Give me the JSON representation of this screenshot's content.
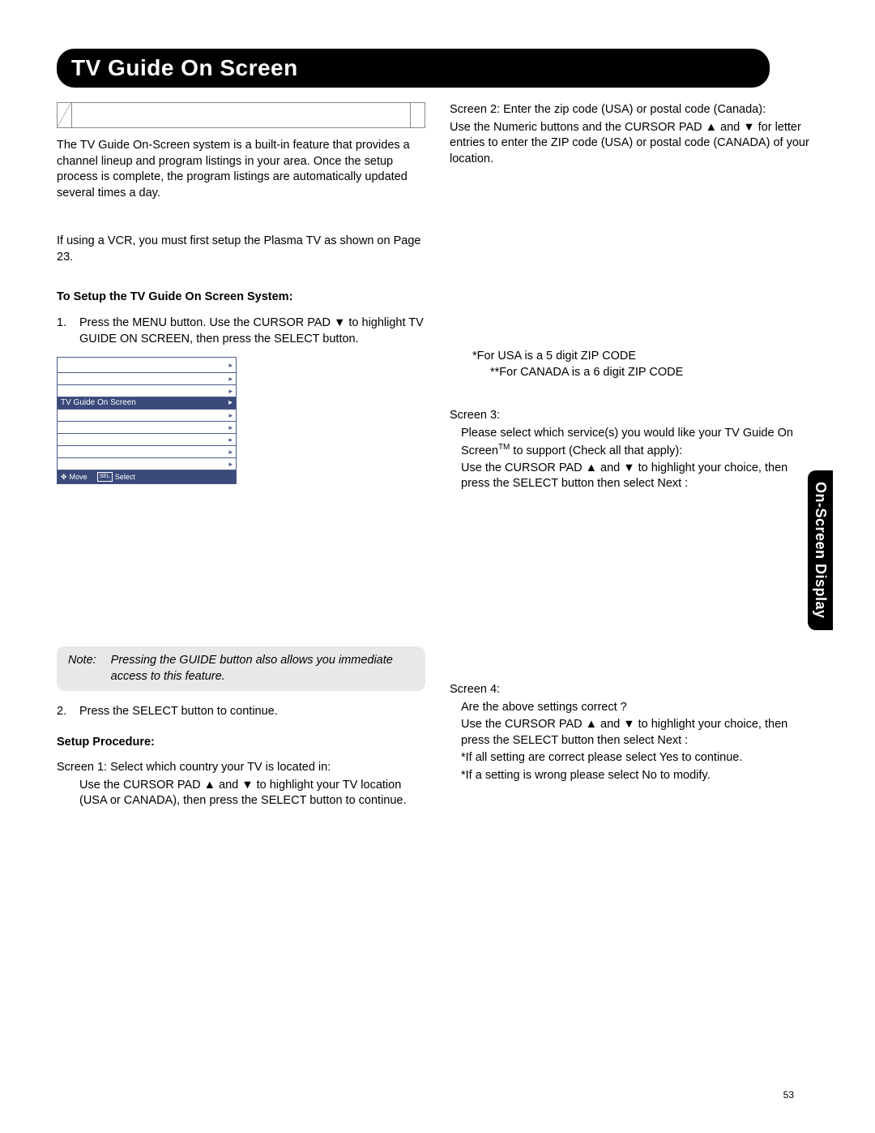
{
  "title": "TV Guide On Screen",
  "sideTab": "On-Screen Display",
  "pageNumber": "53",
  "left": {
    "intro": "The TV Guide On-Screen system is a built-in feature that provides a channel lineup and program listings in your area.  Once the setup process is complete, the program listings are automatically updated several times a day.",
    "vcrNote": "If using a  VCR, you must first setup the Plasma TV as shown on Page 23.",
    "setupHead": "To Setup the TV Guide On Screen System:",
    "step1": "Press the MENU button.  Use the CURSOR PAD ▼ to highlight TV GUIDE ON SCREEN, then press the SELECT button.",
    "menuItem": "TV Guide On Screen",
    "menuFoot": {
      "move": "Move",
      "select": "Select",
      "selBox": "SEL"
    },
    "noteLabel": "Note:",
    "noteText": "Pressing the GUIDE button also allows you immediate access to this feature.",
    "step2": "Press the SELECT button to continue.",
    "procHead": "Setup Procedure:",
    "screen1a": "Screen 1:  Select which country your TV is located in:",
    "screen1b": "Use the CURSOR PAD ▲ and ▼ to highlight your TV location (USA or CANADA), then press the SELECT button to continue."
  },
  "right": {
    "screen2a": "Screen 2:  Enter the zip code (USA) or postal code (Canada):",
    "screen2b": "Use the Numeric buttons and the CURSOR PAD ▲ and ▼ for letter entries to enter the ZIP code (USA) or postal code (CANADA) of your location.",
    "zipUsa": "*For USA is a 5 digit ZIP CODE",
    "zipCan": "**For CANADA is a 6 digit ZIP CODE",
    "screen3": "Screen 3:",
    "screen3a_pre": "Please select which service(s) you would like your TV Guide On Screen",
    "screen3a_tm": "TM",
    "screen3a_post": " to support (Check all that apply):",
    "screen3b": "Use the CURSOR PAD ▲ and ▼ to highlight your choice, then press the SELECT button then select Next :",
    "screen4": "Screen 4:",
    "screen4a": "Are the above settings correct ?",
    "screen4b": "Use the CURSOR PAD ▲ and ▼ to highlight your choice, then press the SELECT button then select Next :",
    "screen4c": "*If all setting are correct please select Yes to continue.",
    "screen4d": "*If a setting is wrong please select No to modify."
  }
}
